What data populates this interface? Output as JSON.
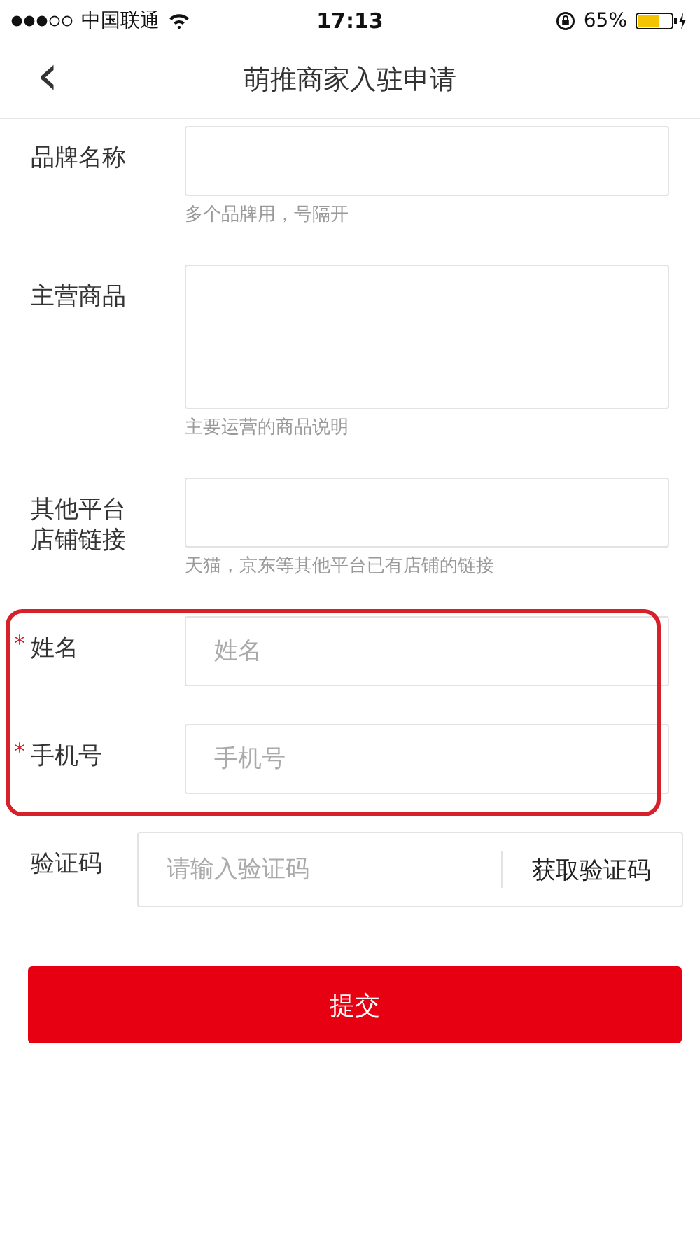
{
  "status_bar": {
    "carrier": "中国联通",
    "time": "17:13",
    "battery": "65%"
  },
  "nav": {
    "back": "‹",
    "title": "萌推商家入驻申请"
  },
  "sections": [
    {
      "highlighted": false,
      "fields": [
        {
          "kind": "input",
          "label": "品牌名称",
          "hint": "多个品牌用，号隔开"
        },
        {
          "kind": "textarea",
          "label": "主营商品",
          "hint": "主要运营的商品说明"
        },
        {
          "kind": "input",
          "label": "其他平台店铺链接",
          "hint": "天猫，京东等其他平台已有店铺的链接"
        }
      ]
    },
    {
      "highlighted": true,
      "fields": [
        {
          "kind": "input",
          "label": "姓名",
          "required_mark": "*",
          "placeholder": "姓名"
        },
        {
          "kind": "input",
          "label": "手机号",
          "required_mark": "*",
          "placeholder": "手机号"
        }
      ]
    },
    {
      "highlighted": false,
      "fields": [
        {
          "kind": "code",
          "label": "验证码",
          "placeholder": "请输入验证码",
          "action": "获取验证码"
        }
      ]
    }
  ],
  "submit": "提交"
}
